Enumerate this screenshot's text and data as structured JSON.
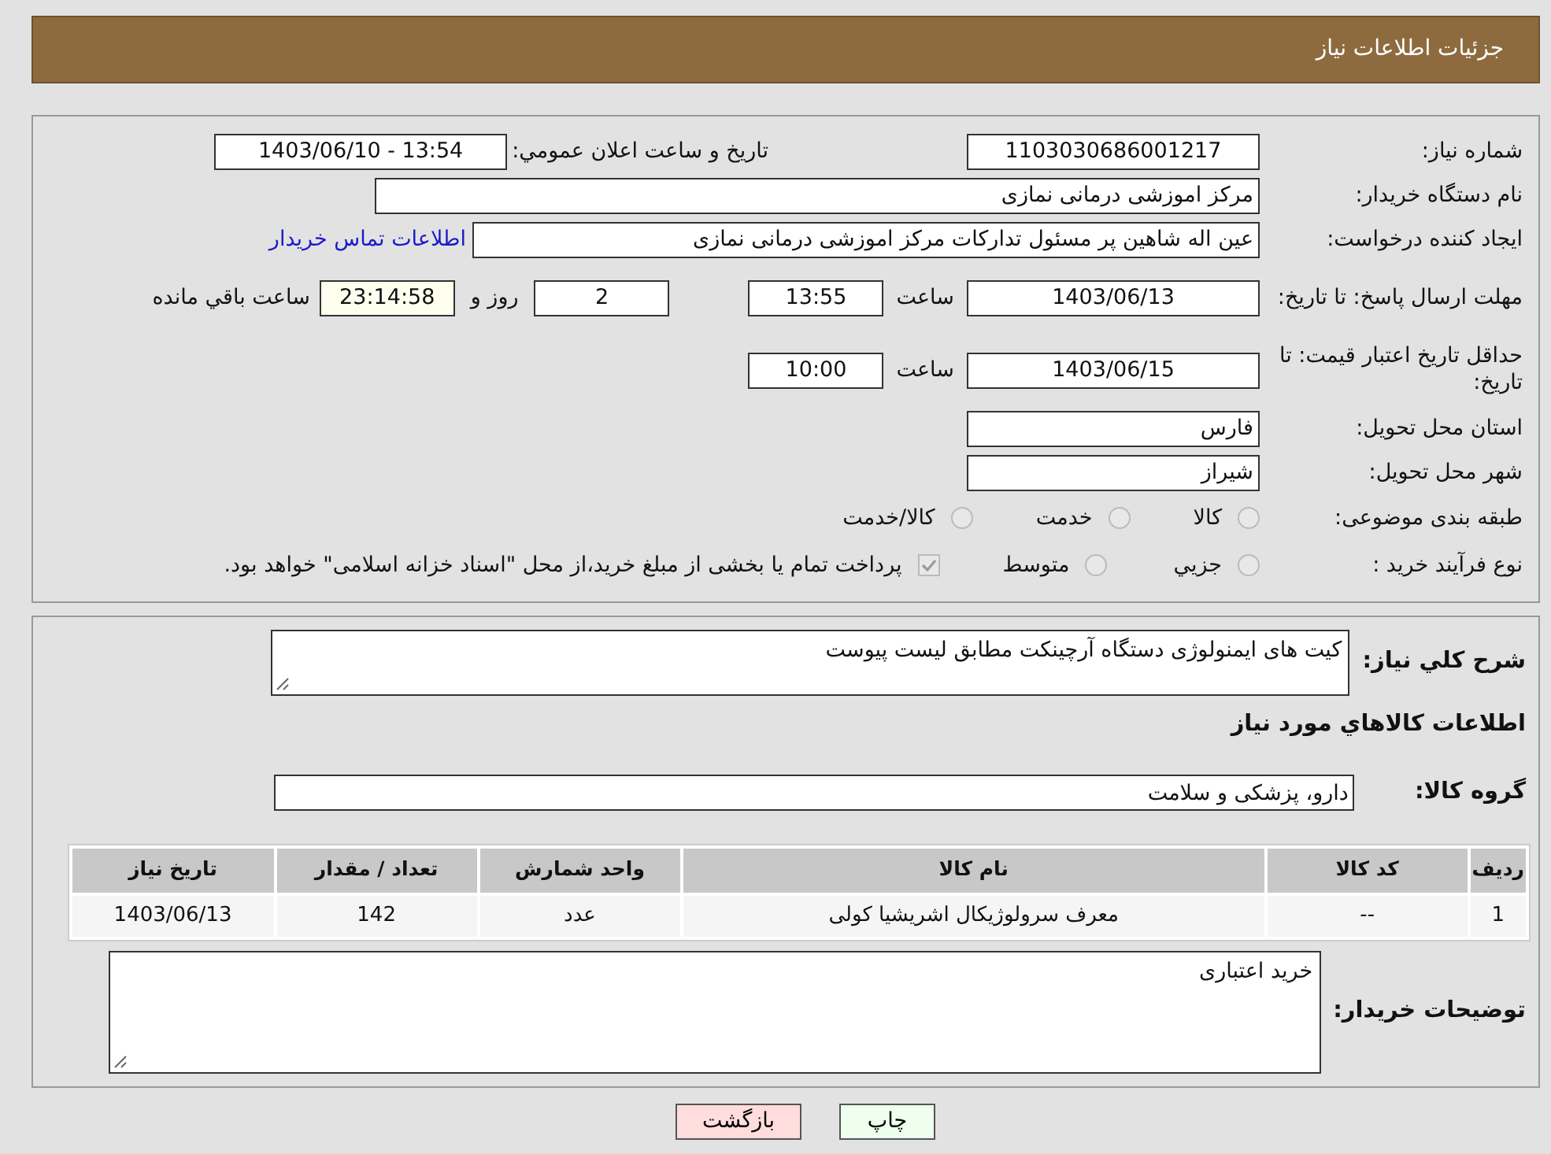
{
  "header": {
    "title": "جزئیات اطلاعات نیاز"
  },
  "need_number": {
    "label": "شماره نیاز:",
    "value": "1103030686001217"
  },
  "announce": {
    "label": "تاریخ و ساعت اعلان عمومي:",
    "value": "1403/06/10 - 13:54"
  },
  "buyer_org": {
    "label": "نام دستگاه خریدار:",
    "value": "مرکز اموزشی درمانی نمازی"
  },
  "requester": {
    "label": "ایجاد کننده درخواست:",
    "value": "عین اله شاهین پر مسئول تدارکات مرکز اموزشی درمانی نمازی",
    "link": "اطلاعات تماس خریدار"
  },
  "deadline": {
    "label": "مهلت ارسال پاسخ: تا تاریخ:",
    "date": "1403/06/13",
    "time_label": "ساعت",
    "time": "13:55",
    "days": "2",
    "days_label": "روز و",
    "remaining": "23:14:58",
    "remaining_label": "ساعت باقي مانده"
  },
  "validity": {
    "label": "حداقل تاریخ اعتبار قیمت: تا تاریخ:",
    "date": "1403/06/15",
    "time_label": "ساعت",
    "time": "10:00"
  },
  "province": {
    "label": "استان محل تحویل:",
    "value": "فارس"
  },
  "city": {
    "label": "شهر محل تحویل:",
    "value": "شیراز"
  },
  "category": {
    "label": "طبقه بندی موضوعی:",
    "options": [
      {
        "label": "کالا",
        "selected": false
      },
      {
        "label": "خدمت",
        "selected": false
      },
      {
        "label": "کالا/خدمت",
        "selected": false
      }
    ]
  },
  "process": {
    "label": "نوع فرآیند خرید :",
    "options": [
      {
        "label": "جزيي",
        "selected": false
      },
      {
        "label": "متوسط",
        "selected": false
      }
    ],
    "payment": {
      "checked": true,
      "text": "پرداخت تمام یا بخشی از مبلغ خرید،از محل \"اسناد خزانه اسلامی\" خواهد بود."
    }
  },
  "description": {
    "label": "شرح کلي نياز:",
    "value": "کیت های ایمنولوژی دستگاه آرچینکت مطابق لیست پیوست"
  },
  "goods_heading": "اطلاعات کالاهاي مورد نياز",
  "goods_group": {
    "label": "گروه کالا:",
    "value": "دارو، پزشکی و سلامت"
  },
  "table": {
    "columns": [
      "ردیف",
      "کد کالا",
      "نام کالا",
      "واحد شمارش",
      "تعداد / مقدار",
      "تاریخ نیاز"
    ],
    "rows": [
      [
        "1",
        "--",
        "معرف سرولوژیکال اشریشیا کولی",
        "عدد",
        "142",
        "1403/06/13"
      ]
    ]
  },
  "buyer_notes": {
    "label": "توضیحات خریدار:",
    "value": "خرید اعتباری"
  },
  "buttons": [
    {
      "kind": "print",
      "label": "چاپ"
    },
    {
      "kind": "back",
      "label": "بازگشت"
    }
  ]
}
